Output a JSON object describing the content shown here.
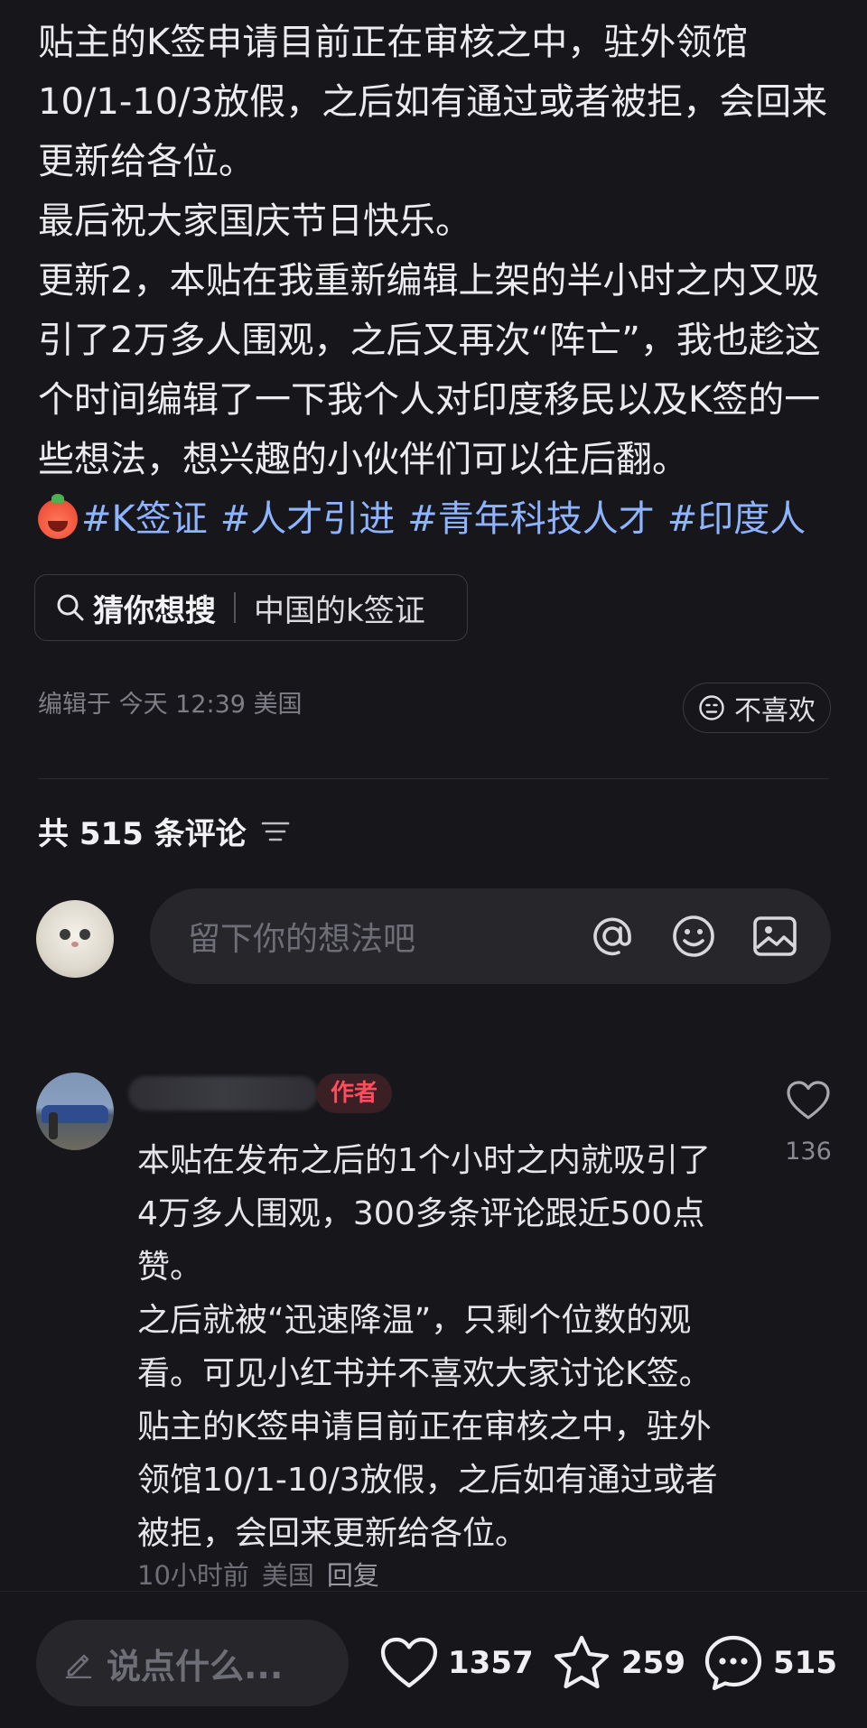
{
  "post": {
    "lines": [
      "贴主的K签申请目前正在审核之中，驻外领馆",
      "10/1-10/3放假，之后如有通过或者被拒，会回来",
      "更新给各位。",
      "最后祝大家国庆节日快乐。",
      "更新2，本贴在我重新编辑上架的半小时之内又吸",
      "引了2万多人围观，之后又再次“阵亡”，我也趁这",
      "个时间编辑了一下我个人对印度移民以及K签的一",
      "些想法，想兴趣的小伙伴们可以往后翻。"
    ],
    "tags": [
      "#K签证",
      "#人才引进",
      "#青年科技人才",
      "#印度人"
    ]
  },
  "guess": {
    "label": "猜你想搜",
    "query": "中国的k签证"
  },
  "meta": {
    "edited": "编辑于 今天 12:39 美国",
    "dislike_label": "不喜欢"
  },
  "comments": {
    "title": "共 515 条评论",
    "input_placeholder": "留下你的想法吧",
    "items": [
      {
        "badge": "作者",
        "likes": "136",
        "lines": [
          "本贴在发布之后的1个小时之内就吸引了",
          "4万多人围观，300多条评论跟近500点",
          "赞。",
          "之后就被“迅速降温”，只剩个位数的观",
          "看。可见小红书并不喜欢大家讨论K签。",
          "贴主的K签申请目前正在审核之中，驻外",
          "领馆10/1-10/3放假，之后如有通过或者",
          "被拒，会回来更新给各位。"
        ],
        "time": "10小时前",
        "location": "美国",
        "reply_label": "回复"
      }
    ]
  },
  "bottom": {
    "say_placeholder": "说点什么...",
    "likes": "1357",
    "stars": "259",
    "comments": "515"
  },
  "colors": {
    "background": "#17171b",
    "tag": "#8fb4ff",
    "author_badge": "#ff4d5e"
  }
}
